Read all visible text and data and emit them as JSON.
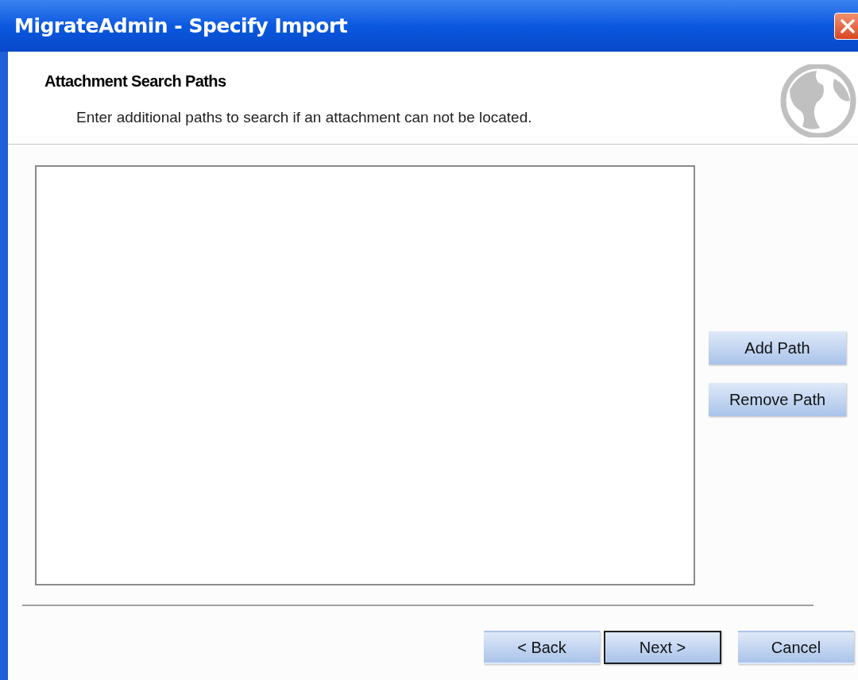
{
  "window": {
    "title": "MigrateAdmin - Specify Import"
  },
  "header": {
    "title": "Attachment Search Paths",
    "description": "Enter additional paths to search if an attachment can not be located."
  },
  "side_buttons": [
    "Add Path",
    "Remove Path"
  ],
  "footer_buttons": [
    {
      "label": "< Back",
      "default": false
    },
    {
      "label": "Next >",
      "default": true
    },
    {
      "label": "Cancel",
      "default": false
    }
  ]
}
